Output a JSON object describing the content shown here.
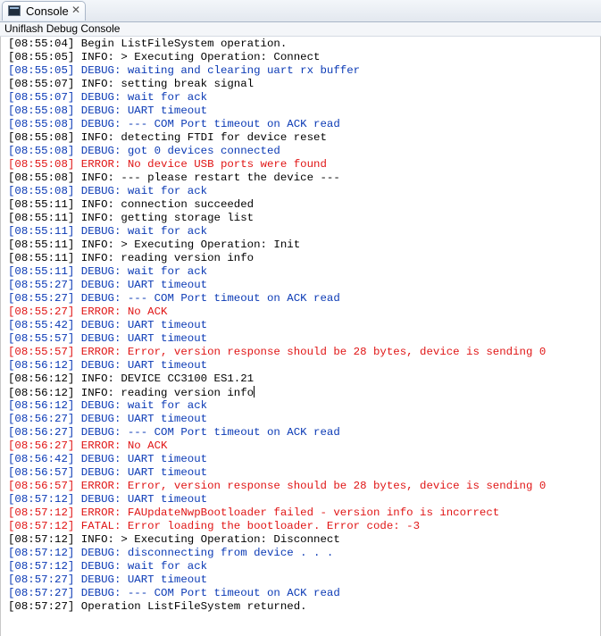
{
  "tab": {
    "label": "Console",
    "icon": "console-icon"
  },
  "view": {
    "title": "Uniflash Debug Console"
  },
  "colors": {
    "normal": "#000000",
    "debug": "#0b3ab5",
    "error": "#e01515"
  },
  "console": {
    "lines": [
      {
        "level": "normal",
        "text": "[08:55:04] Begin ListFileSystem operation."
      },
      {
        "level": "normal",
        "text": "[08:55:05] INFO: > Executing Operation: Connect"
      },
      {
        "level": "debug",
        "text": "[08:55:05] DEBUG: waiting and clearing uart rx buffer"
      },
      {
        "level": "normal",
        "text": "[08:55:07] INFO: setting break signal"
      },
      {
        "level": "debug",
        "text": "[08:55:07] DEBUG: wait for ack"
      },
      {
        "level": "debug",
        "text": "[08:55:08] DEBUG: UART timeout"
      },
      {
        "level": "debug",
        "text": "[08:55:08] DEBUG: --- COM Port timeout on ACK read"
      },
      {
        "level": "normal",
        "text": "[08:55:08] INFO: detecting FTDI for device reset"
      },
      {
        "level": "debug",
        "text": "[08:55:08] DEBUG: got 0 devices connected"
      },
      {
        "level": "error",
        "text": "[08:55:08] ERROR: No device USB ports were found"
      },
      {
        "level": "normal",
        "text": "[08:55:08] INFO: --- please restart the device ---"
      },
      {
        "level": "debug",
        "text": "[08:55:08] DEBUG: wait for ack"
      },
      {
        "level": "normal",
        "text": "[08:55:11] INFO: connection succeeded"
      },
      {
        "level": "normal",
        "text": "[08:55:11] INFO: getting storage list"
      },
      {
        "level": "debug",
        "text": "[08:55:11] DEBUG: wait for ack"
      },
      {
        "level": "normal",
        "text": "[08:55:11] INFO: > Executing Operation: Init"
      },
      {
        "level": "normal",
        "text": "[08:55:11] INFO: reading version info"
      },
      {
        "level": "debug",
        "text": "[08:55:11] DEBUG: wait for ack"
      },
      {
        "level": "debug",
        "text": "[08:55:27] DEBUG: UART timeout"
      },
      {
        "level": "debug",
        "text": "[08:55:27] DEBUG: --- COM Port timeout on ACK read"
      },
      {
        "level": "error",
        "text": "[08:55:27] ERROR: No ACK"
      },
      {
        "level": "debug",
        "text": "[08:55:42] DEBUG: UART timeout"
      },
      {
        "level": "debug",
        "text": "[08:55:57] DEBUG: UART timeout"
      },
      {
        "level": "error",
        "text": "[08:55:57] ERROR: Error, version response should be 28 bytes, device is sending 0"
      },
      {
        "level": "debug",
        "text": "[08:56:12] DEBUG: UART timeout"
      },
      {
        "level": "normal",
        "text": "[08:56:12] INFO: DEVICE CC3100 ES1.21"
      },
      {
        "level": "normal",
        "text": "[08:56:12] INFO: reading version info",
        "caret": true
      },
      {
        "level": "debug",
        "text": "[08:56:12] DEBUG: wait for ack"
      },
      {
        "level": "debug",
        "text": "[08:56:27] DEBUG: UART timeout"
      },
      {
        "level": "debug",
        "text": "[08:56:27] DEBUG: --- COM Port timeout on ACK read"
      },
      {
        "level": "error",
        "text": "[08:56:27] ERROR: No ACK"
      },
      {
        "level": "debug",
        "text": "[08:56:42] DEBUG: UART timeout"
      },
      {
        "level": "debug",
        "text": "[08:56:57] DEBUG: UART timeout"
      },
      {
        "level": "error",
        "text": "[08:56:57] ERROR: Error, version response should be 28 bytes, device is sending 0"
      },
      {
        "level": "debug",
        "text": "[08:57:12] DEBUG: UART timeout"
      },
      {
        "level": "error",
        "text": "[08:57:12] ERROR: FAUpdateNwpBootloader failed - version info is incorrect"
      },
      {
        "level": "fatal",
        "text": "[08:57:12] FATAL: Error loading the bootloader. Error code: -3"
      },
      {
        "level": "normal",
        "text": "[08:57:12] INFO: > Executing Operation: Disconnect"
      },
      {
        "level": "debug",
        "text": "[08:57:12] DEBUG: disconnecting from device . . ."
      },
      {
        "level": "debug",
        "text": "[08:57:12] DEBUG: wait for ack"
      },
      {
        "level": "debug",
        "text": "[08:57:27] DEBUG: UART timeout"
      },
      {
        "level": "debug",
        "text": "[08:57:27] DEBUG: --- COM Port timeout on ACK read"
      },
      {
        "level": "normal",
        "text": "[08:57:27] Operation ListFileSystem returned."
      }
    ]
  }
}
